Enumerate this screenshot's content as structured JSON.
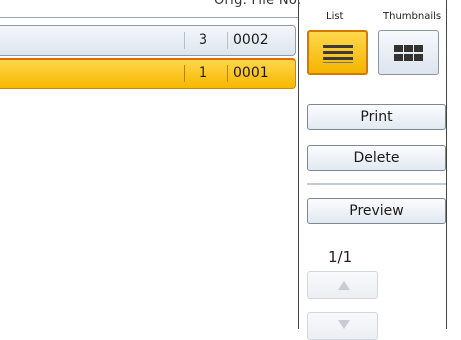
{
  "list_header": {
    "columns_text": "Orig. File No."
  },
  "files": [
    {
      "originals": "3",
      "file_no": "0002",
      "selected": false
    },
    {
      "originals": "1",
      "file_no": "0001",
      "selected": true
    }
  ],
  "view": {
    "list_label": "List",
    "thumbnails_label": "Thumbnails",
    "selected": "list",
    "list_icon": "list-lines-icon",
    "thumbnails_icon": "grid-icon"
  },
  "actions": {
    "print_label": "Print",
    "delete_label": "Delete",
    "preview_label": "Preview"
  },
  "pagination": {
    "page_text": "1/1",
    "up_icon": "scroll-up-arrow-icon",
    "down_icon": "scroll-down-arrow-icon",
    "up_enabled": false,
    "down_enabled": false
  },
  "colors": {
    "selected_fill": "#f7b800",
    "selected_border": "#d17c00",
    "button_border": "#7d8796"
  }
}
